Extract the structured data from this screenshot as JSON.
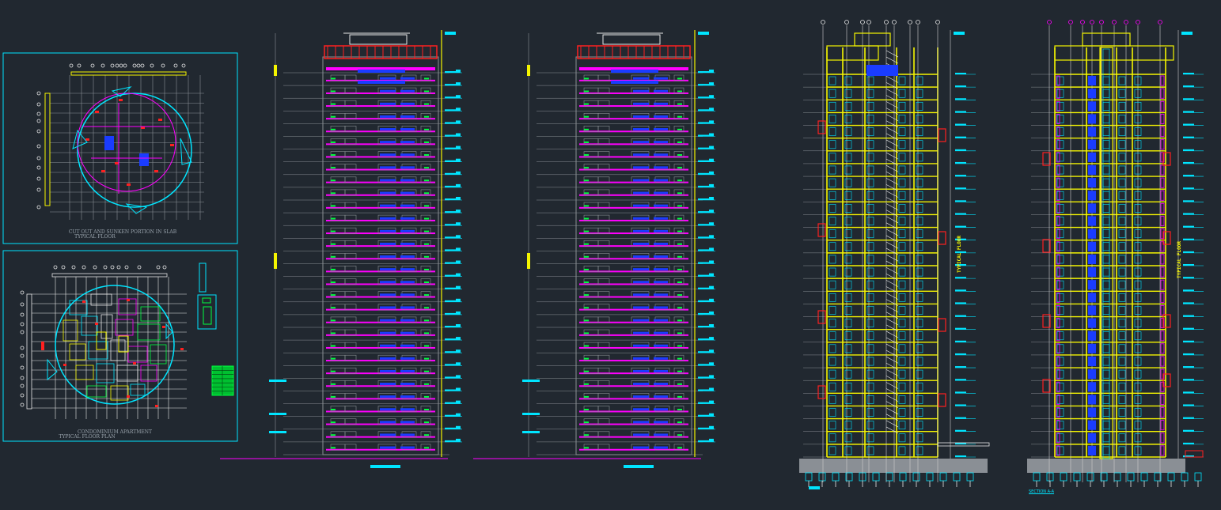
{
  "drawing": {
    "background": "#212830",
    "colors": {
      "cyan": "#00e5ff",
      "yellow": "#f5f500",
      "magenta": "#ff00ff",
      "red": "#ff2020",
      "blue": "#1a3cff",
      "green": "#00ff40",
      "grey": "#8a8f95",
      "white": "#e8e8e8"
    },
    "plan1": {
      "caption_line1": "CUT OUT AND SUNKEN PORTION IN SLAB",
      "caption_line2": "TYPICAL FLOOR"
    },
    "plan2": {
      "caption_line1": "CONDOMINIUM APARTMENT",
      "caption_line2": "TYPICAL FLOOR PLAN"
    },
    "section1": {
      "vertical_label": "TYPICAL FLOOR"
    },
    "section2": {
      "vertical_label": "TYPICAL FLOOR",
      "caption": "SECTION A-A"
    },
    "floors": 30
  }
}
